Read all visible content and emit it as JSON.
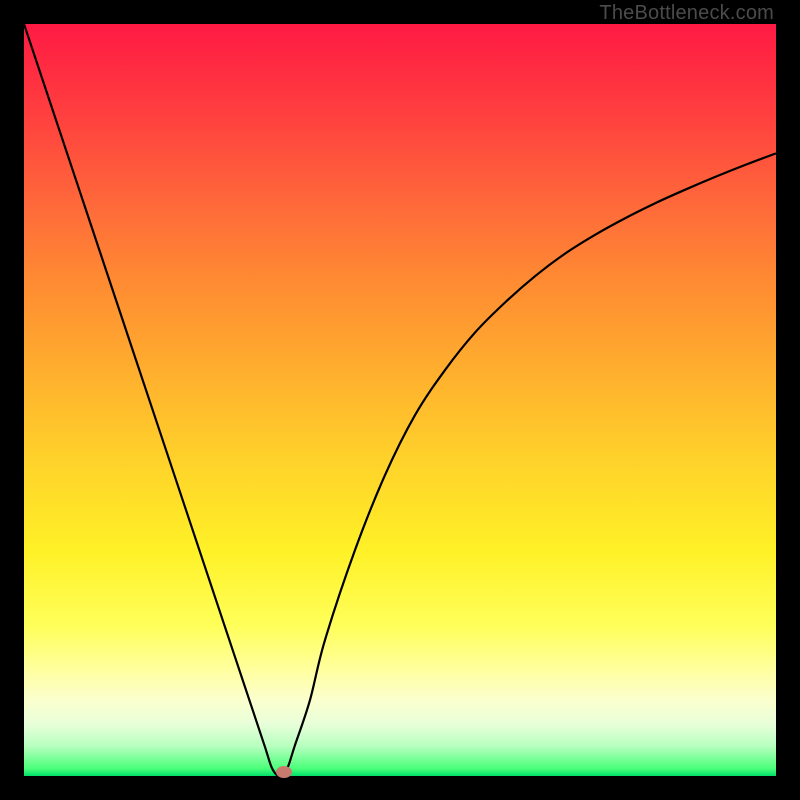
{
  "watermark": "TheBottleneck.com",
  "chart_data": {
    "type": "line",
    "title": "",
    "xlabel": "",
    "ylabel": "",
    "x": [
      0,
      2,
      4,
      6,
      8,
      10,
      12,
      14,
      16,
      18,
      20,
      22,
      24,
      26,
      28,
      30,
      32,
      33,
      34,
      35,
      36,
      38,
      40,
      44,
      48,
      52,
      56,
      60,
      64,
      68,
      72,
      76,
      80,
      84,
      88,
      92,
      96,
      100
    ],
    "values": [
      100,
      94,
      88,
      82,
      76,
      70,
      64,
      58,
      52,
      46,
      40,
      34,
      28,
      22,
      16,
      10,
      4,
      1,
      0,
      1,
      4,
      10,
      18,
      30,
      40,
      48,
      54,
      59,
      63,
      66.5,
      69.5,
      72,
      74.2,
      76.2,
      78,
      79.7,
      81.3,
      82.8
    ],
    "xlim": [
      0,
      100
    ],
    "ylim": [
      0,
      100
    ],
    "marker": {
      "x": 34.6,
      "y": 0.5
    },
    "background_gradient": [
      "#ff1a44",
      "#ffd22a",
      "#fff127",
      "#00e06a"
    ]
  }
}
